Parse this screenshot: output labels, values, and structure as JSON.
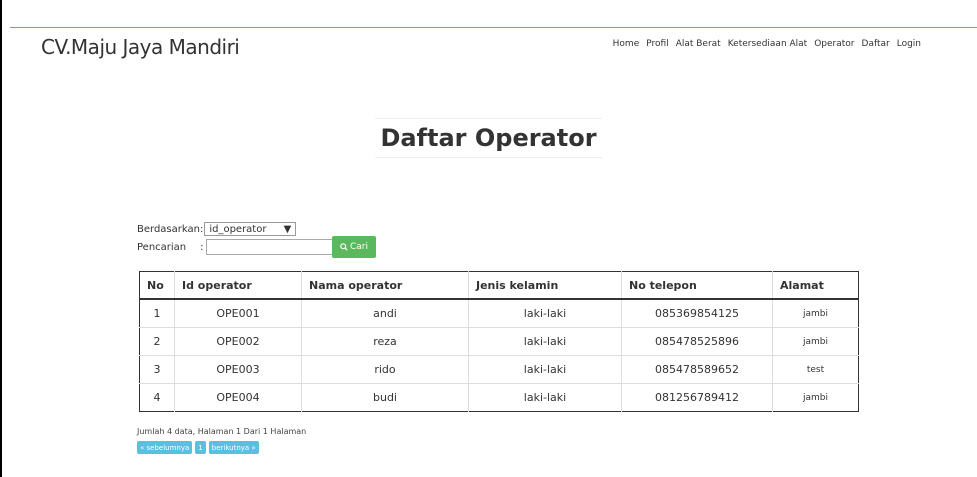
{
  "brand": "CV.Maju Jaya Mandiri",
  "nav": [
    "Home",
    "Profil",
    "Alat Berat",
    "Ketersediaan Alat",
    "Operator",
    "Daftar",
    "Login"
  ],
  "page_title": "Daftar Operator",
  "filter": {
    "berdasarkan_label": "Berdasarkan:",
    "selected_field": "id_operator",
    "pencarian_label": "Pencarian",
    "colon": ":",
    "search_value": "",
    "cari_label": "Cari"
  },
  "table": {
    "headers": [
      "No",
      "Id operator",
      "Nama operator",
      "Jenis kelamin",
      "No telepon",
      "Alamat"
    ],
    "rows": [
      [
        "1",
        "OPE001",
        "andi",
        "laki-laki",
        "085369854125",
        "jambi"
      ],
      [
        "2",
        "OPE002",
        "reza",
        "laki-laki",
        "085478525896",
        "jambi"
      ],
      [
        "3",
        "OPE003",
        "rido",
        "laki-laki",
        "085478589652",
        "test"
      ],
      [
        "4",
        "OPE004",
        "budi",
        "laki-laki",
        "081256789412",
        "jambi"
      ]
    ]
  },
  "footer": {
    "info": "Jumlah 4 data, Halaman 1 Dari 1 Halaman",
    "prev": "« sebelumnya",
    "page": "1",
    "next": "berikutnya »"
  },
  "colors": {
    "accent_line": "#e8793a",
    "cari_button": "#5cb85c",
    "pager": "#5bc0de"
  }
}
